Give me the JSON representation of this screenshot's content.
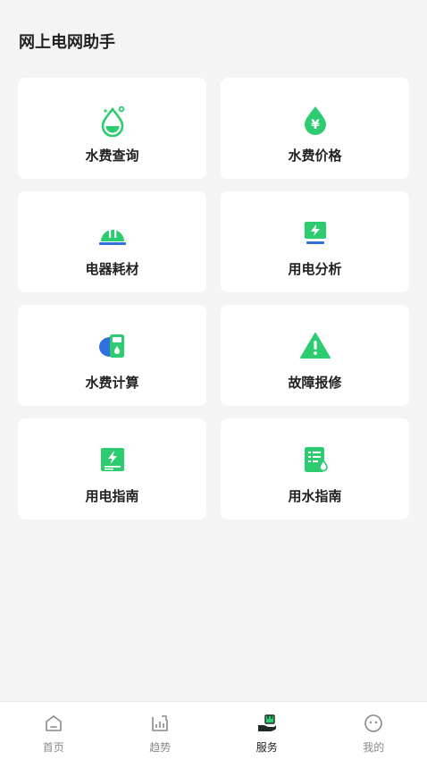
{
  "header": {
    "title": "网上电网助手"
  },
  "colors": {
    "accent": "#2ecc71",
    "accent_dark": "#1e9e52",
    "blue": "#2f6fe0",
    "text": "#222222",
    "muted": "#888888"
  },
  "cards": [
    {
      "label": "水费查询",
      "icon": "water-drop-icon"
    },
    {
      "label": "水费价格",
      "icon": "yen-drop-icon"
    },
    {
      "label": "电器耗材",
      "icon": "helmet-icon"
    },
    {
      "label": "用电分析",
      "icon": "monitor-lightning-icon"
    },
    {
      "label": "水费计算",
      "icon": "calculator-icon"
    },
    {
      "label": "故障报修",
      "icon": "warning-icon"
    },
    {
      "label": "用电指南",
      "icon": "lightning-doc-icon"
    },
    {
      "label": "用水指南",
      "icon": "water-doc-icon"
    }
  ],
  "tabbar": {
    "items": [
      {
        "label": "首页",
        "icon": "home-icon"
      },
      {
        "label": "趋势",
        "icon": "trend-chart-icon"
      },
      {
        "label": "服务",
        "icon": "service-hand-icon",
        "active": true
      },
      {
        "label": "我的",
        "icon": "profile-face-icon"
      }
    ]
  }
}
